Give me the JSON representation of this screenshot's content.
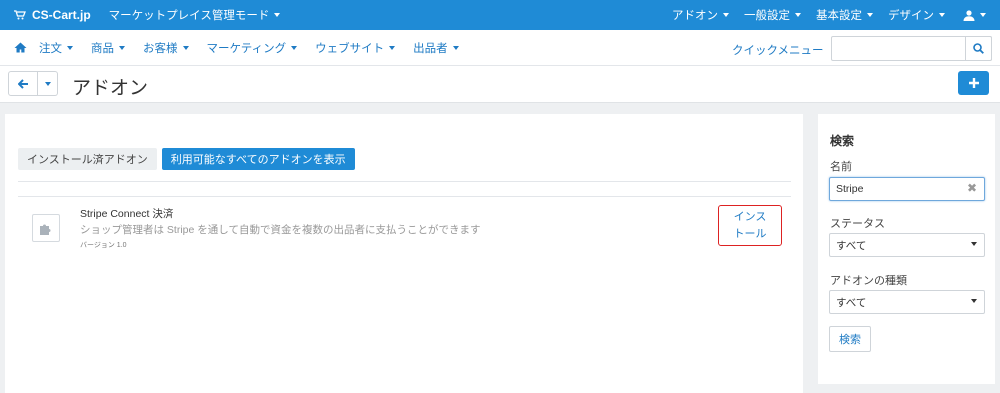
{
  "topbar": {
    "brand": "CS-Cart.jp",
    "mode": "マーケットプレイス管理モード",
    "menus": [
      "アドオン",
      "一般設定",
      "基本設定",
      "デザイン"
    ]
  },
  "nav": {
    "items": [
      "注文",
      "商品",
      "お客様",
      "マーケティング",
      "ウェブサイト",
      "出品者"
    ],
    "quick_menu": "クイックメニュー",
    "search_placeholder": ""
  },
  "page": {
    "title": "アドオン"
  },
  "tabs": {
    "installed": "インストール済アドオン",
    "all": "利用可能なすべてのアドオンを表示"
  },
  "addon": {
    "name": "Stripe Connect 決済",
    "description": "ショップ管理者は Stripe を通して自動で資金を複数の出品者に支払うことができます",
    "version": "バージョン 1.0",
    "install_line1": "インス",
    "install_line2": "トール"
  },
  "sidebar": {
    "heading": "検索",
    "name_label": "名前",
    "name_value": "Stripe",
    "status_label": "ステータス",
    "status_value": "すべて",
    "type_label": "アドオンの種類",
    "type_value": "すべて",
    "search_button": "検索"
  },
  "colors": {
    "primary": "#1f8bd6",
    "link": "#1f7bc4",
    "highlight_border": "#dd2222"
  }
}
